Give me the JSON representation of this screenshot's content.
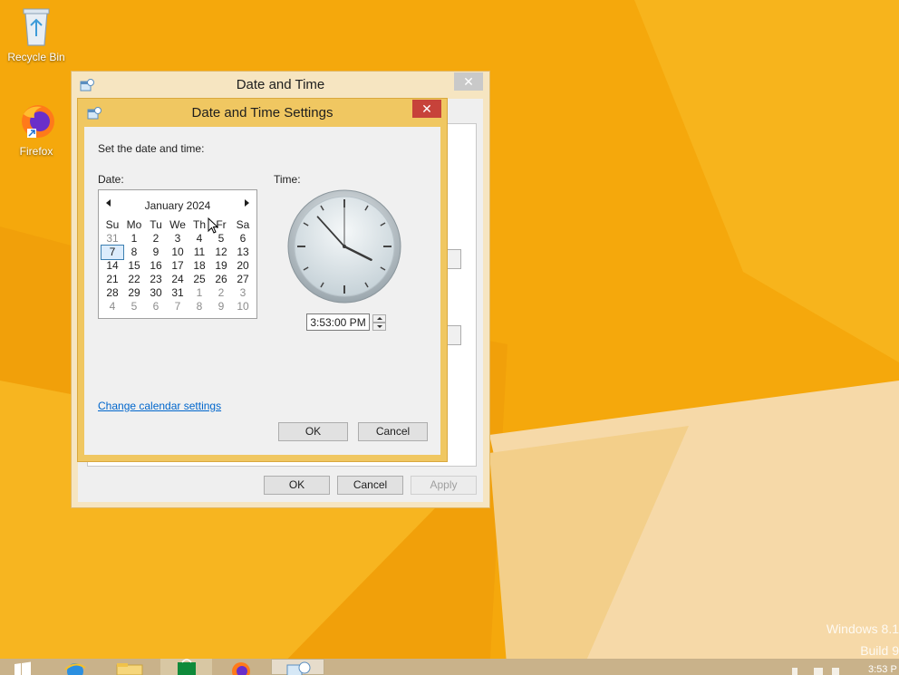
{
  "desktop": {
    "icons": [
      {
        "label": "Recycle Bin",
        "icon": "recycle-bin-icon"
      },
      {
        "label": "Firefox",
        "icon": "firefox-icon"
      }
    ],
    "watermark_line1": "Windows 8.1",
    "watermark_line2": "Build 9"
  },
  "outer_window": {
    "title": "Date and Time",
    "buttons": {
      "ok": "OK",
      "cancel": "Cancel",
      "apply": "Apply"
    }
  },
  "settings_dialog": {
    "title": "Date and Time Settings",
    "instruction": "Set the date and time:",
    "date_label": "Date:",
    "time_label": "Time:",
    "calendar": {
      "month_year": "January 2024",
      "weekdays": [
        "Su",
        "Mo",
        "Tu",
        "We",
        "Th",
        "Fr",
        "Sa"
      ],
      "weeks": [
        [
          "31",
          "1",
          "2",
          "3",
          "4",
          "5",
          "6"
        ],
        [
          "7",
          "8",
          "9",
          "10",
          "11",
          "12",
          "13"
        ],
        [
          "14",
          "15",
          "16",
          "17",
          "18",
          "19",
          "20"
        ],
        [
          "21",
          "22",
          "23",
          "24",
          "25",
          "26",
          "27"
        ],
        [
          "28",
          "29",
          "30",
          "31",
          "1",
          "2",
          "3"
        ],
        [
          "4",
          "5",
          "6",
          "7",
          "8",
          "9",
          "10"
        ]
      ],
      "selected_day": "7"
    },
    "clock": {
      "hour": 3,
      "minute": 53,
      "second": 0
    },
    "time_value": "3:53:00 PM",
    "change_calendar_link": "Change calendar settings",
    "ok_label": "OK",
    "cancel_label": "Cancel"
  },
  "taskbar": {
    "items": [
      "start-button-icon",
      "internet-explorer-icon",
      "file-explorer-icon",
      "store-icon",
      "firefox-icon",
      "date-time-icon"
    ],
    "clock_text": "3:53 P"
  }
}
